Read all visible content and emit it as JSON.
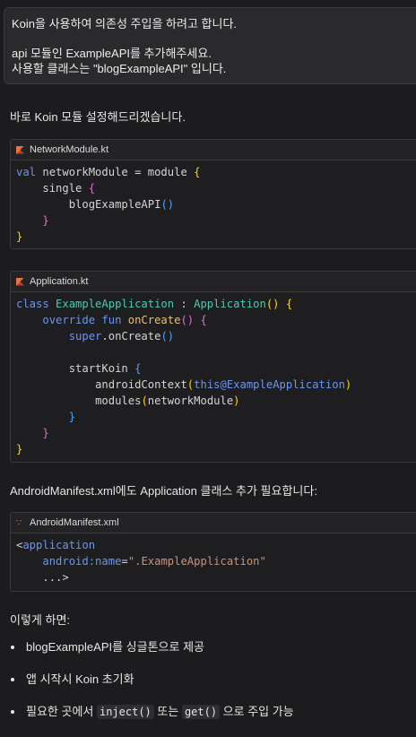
{
  "user_message": {
    "line1": "Koin을 사용하여 의존성 주입을 하려고 합니다.",
    "line2": "api 모듈인  ExampleAPI를 추가해주세요.",
    "line3": "사용할 클래스는 \"blogExampleAPI\" 입니다."
  },
  "reply": {
    "intro": "바로 Koin 모듈 설정해드리겠습니다.",
    "manifest_note": "AndroidManifest.xml에도 Application 클래스 추가 필요합니다:",
    "summary_heading": "이렇게 하면:",
    "bullets": {
      "b1": "blogExampleAPI를 싱글톤으로 제공",
      "b2": "앱 시작시 Koin 초기화",
      "b3_prefix": "필요한 곳에서 ",
      "b3_code1": "inject()",
      "b3_mid": " 또는 ",
      "b3_code2": "get()",
      "b3_suffix": " 으로 주입 가능"
    }
  },
  "code_blocks": {
    "network": {
      "filename": "NetworkModule.kt",
      "icon": "kotlin-icon",
      "tokens": {
        "val": "val",
        "networkModule": " networkModule = module ",
        "open": "{",
        "single": "single ",
        "singleOpen": "{",
        "api": "blogExampleAPI",
        "parens": "()",
        "singleClose": "}",
        "close": "}"
      }
    },
    "application": {
      "filename": "Application.kt",
      "icon": "kotlin-icon",
      "tokens": {
        "class": "class ",
        "name": "ExampleApplication",
        "colon": " : ",
        "parent": "Application",
        "parentParens": "()",
        "open": " {",
        "override": "override fun ",
        "onCreate": "onCreate",
        "onCreateParens": "()",
        "onCreateOpen": " {",
        "super": "super",
        "superCall": ".onCreate",
        "superParens": "()",
        "startKoin": "startKoin ",
        "skOpen": "{",
        "androidContext": "androidContext",
        "acOpen": "(",
        "this": "this@ExampleApplication",
        "acClose": ")",
        "modules": "modules",
        "mOpen": "(",
        "mArg": "networkModule",
        "mClose": ")",
        "skClose": "}",
        "ocClose": "}",
        "close": "}"
      }
    },
    "manifest": {
      "filename": "AndroidManifest.xml",
      "icon": "rss-icon",
      "tokens": {
        "lt": "<",
        "application": "application",
        "attr": "android:name",
        "eq": "=",
        "value": "\".ExampleApplication\"",
        "ellipsis": "...>"
      }
    }
  }
}
